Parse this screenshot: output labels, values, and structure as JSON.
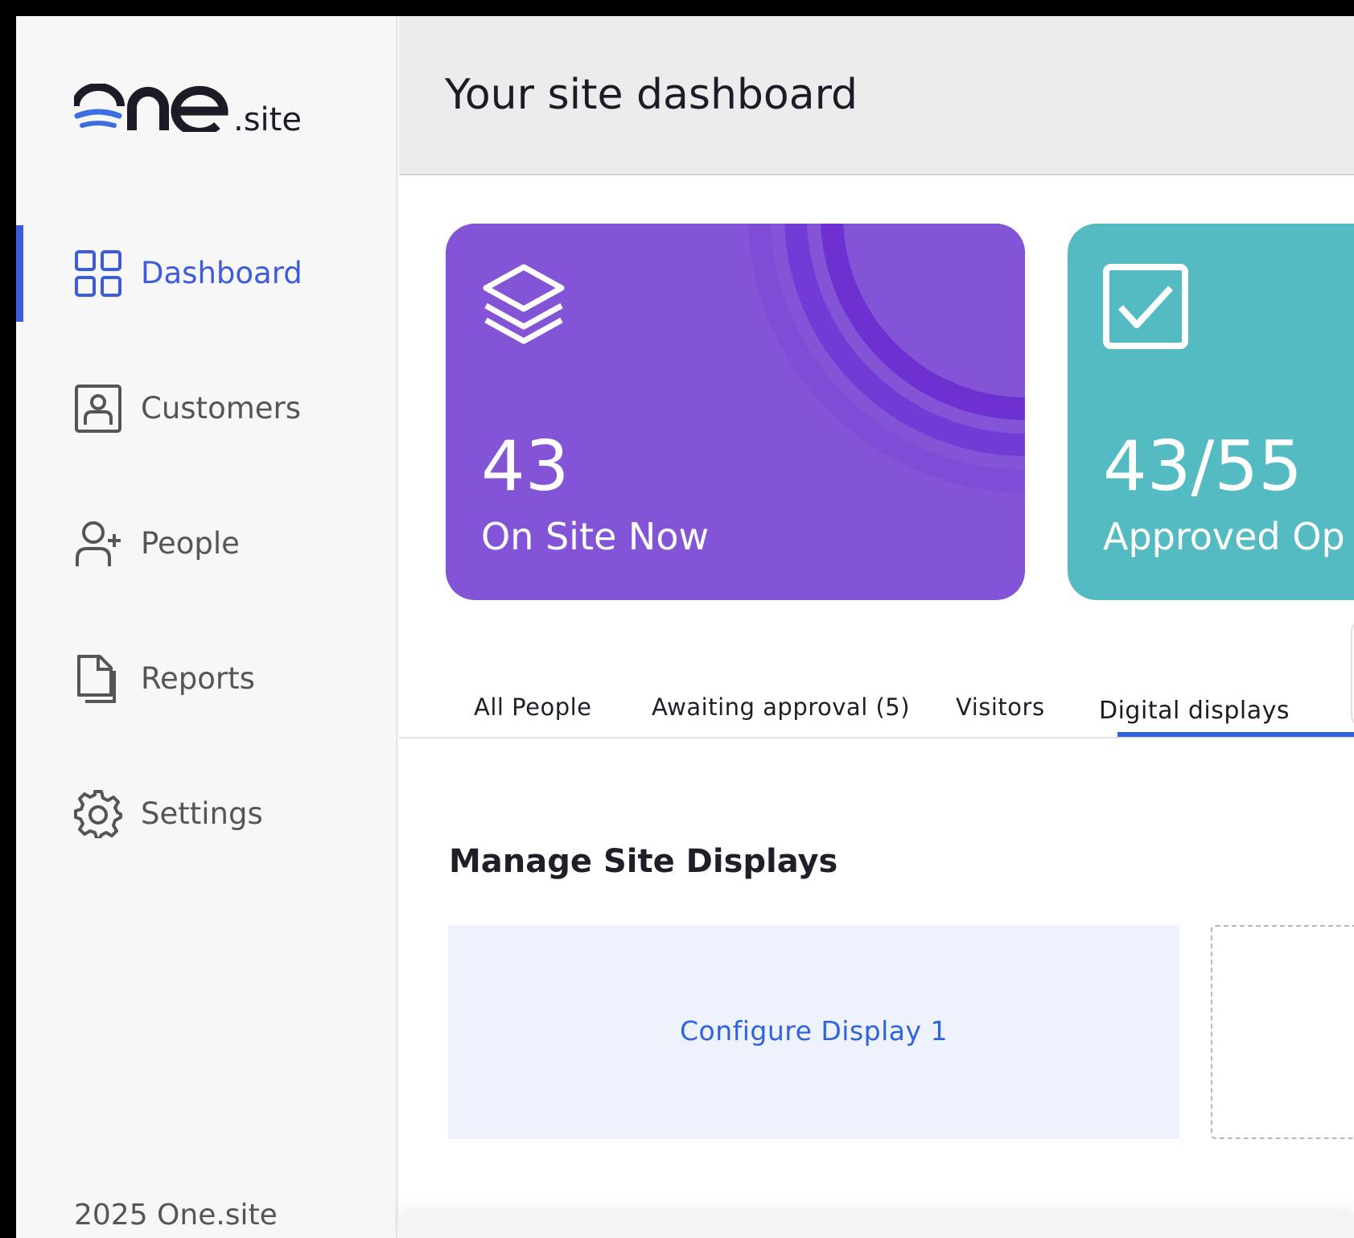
{
  "brand": {
    "logo_text": "one",
    "logo_suffix": ".site",
    "accent": "#3d5bdc"
  },
  "sidebar": {
    "items": [
      {
        "label": "Dashboard",
        "icon": "grid-icon",
        "active": true
      },
      {
        "label": "Customers",
        "icon": "contact-card-icon",
        "active": false
      },
      {
        "label": "People",
        "icon": "user-plus-icon",
        "active": false
      },
      {
        "label": "Reports",
        "icon": "document-icon",
        "active": false
      },
      {
        "label": "Settings",
        "icon": "gear-icon",
        "active": false
      }
    ],
    "footer": "2025 One.site"
  },
  "header": {
    "title": "Your site dashboard"
  },
  "stats": [
    {
      "value": "43",
      "label": "On Site Now",
      "icon": "layers-icon",
      "color": "#8454d7"
    },
    {
      "value": "43/55",
      "label": "Approved Op",
      "icon": "checkbox-icon",
      "color": "#55bbc2"
    }
  ],
  "tabs": [
    {
      "label": "All People",
      "active": false
    },
    {
      "label": "Awaiting approval (5)",
      "active": false
    },
    {
      "label": "Visitors",
      "active": false
    },
    {
      "label": "Digital displays",
      "active": true
    }
  ],
  "displays": {
    "section_title": "Manage Site Displays",
    "items": [
      {
        "label": "Configure Display 1"
      }
    ]
  }
}
